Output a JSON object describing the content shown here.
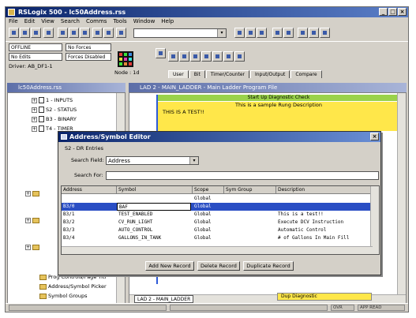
{
  "window": {
    "title": "RSLogix 500 - lc50Address.rss",
    "min_glyph": "_",
    "max_glyph": "□",
    "close_glyph": "×"
  },
  "menu": [
    "File",
    "Edit",
    "View",
    "Search",
    "Comms",
    "Tools",
    "Window",
    "Help"
  ],
  "toolbar": {
    "combo_value": "",
    "dropdown_glyph": "▾"
  },
  "status_panel": {
    "mode": "OFFLINE",
    "forces": "No Forces",
    "edits": "No Edits",
    "forces_state": "Forces Disabled",
    "driver": "Driver: AB_DF1-1",
    "node": "Node : 1d"
  },
  "instruction_tabs": [
    "User",
    "Bit",
    "Timer/Counter",
    "Input/Output",
    "Compare"
  ],
  "project_tree": {
    "title": "lc50Address.rss",
    "items": [
      "1 - INPUTS",
      "S2 - STATUS",
      "B3 - BINARY",
      "T4 - TIMER"
    ],
    "bottom_items": [
      "Prog Controls/Page Titl",
      "Address/Symbol Picker",
      "Symbol Groups"
    ]
  },
  "ladder": {
    "title": "LAD 2 - MAIN_LADDER - Main Ladder Program File",
    "rung_title": "Start Up Diagnostic Check",
    "rung_desc": "This is a sample Rung Description",
    "rung_text": "THIS IS A TEST!!",
    "file_tab": "LAD 2 - MAIN_LADDER",
    "bottom_label": "Dup Diagnostic"
  },
  "dialog": {
    "title": "Address/Symbol Editor",
    "data_file_label": "S2 - DR Entries",
    "search_field_label": "Search Field:",
    "search_field_value": "Address",
    "search_for_label": "Search For:",
    "search_for_value": "",
    "columns": [
      "Address",
      "Symbol",
      "Scope",
      "Sym Group",
      "Description"
    ],
    "rows": [
      {
        "address": "",
        "symbol": "",
        "scope": "Global",
        "group": "",
        "description": ""
      },
      {
        "address": "B3/0",
        "symbol": "BAF",
        "scope": "Global",
        "group": "",
        "description": "",
        "selected": true
      },
      {
        "address": "B3/1",
        "symbol": "TEST_ENABLED",
        "scope": "Global",
        "group": "",
        "description": "This is a test!!"
      },
      {
        "address": "B3/2",
        "symbol": "CV_RUN_LIGHT",
        "scope": "Global",
        "group": "",
        "description": "Execute DCV Instruction"
      },
      {
        "address": "B3/3",
        "symbol": "AUTO_CONTROL",
        "scope": "Global",
        "group": "",
        "description": "Automatic Control"
      },
      {
        "address": "B3/4",
        "symbol": "GALLONS_IN_TANK",
        "scope": "Global",
        "group": "",
        "description": "# of Gallons In Main Fill"
      }
    ],
    "buttons": {
      "add": "Add New Record",
      "delete": "Delete Record",
      "duplicate": "Duplicate Record"
    }
  },
  "statusbar": {
    "left": "",
    "mid": "",
    "right1": "OVR",
    "right2": "APP  READ"
  }
}
